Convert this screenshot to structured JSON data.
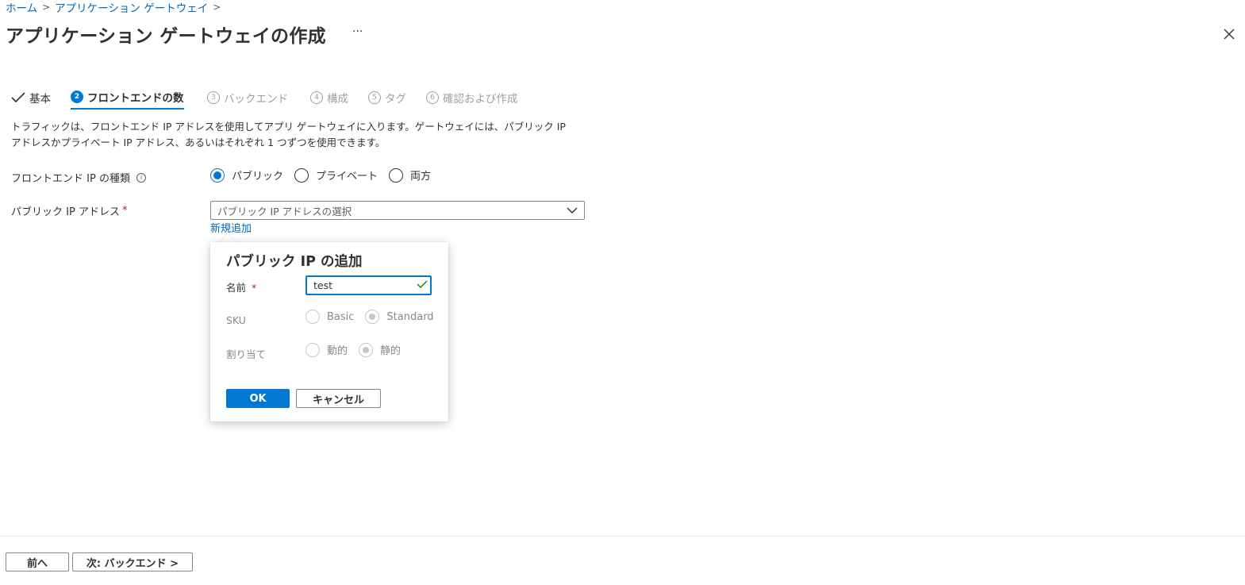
{
  "breadcrumb": {
    "home": "ホーム",
    "separator": ">",
    "app_gateway": "アプリケーション ゲートウェイ"
  },
  "header": {
    "title": "アプリケーション ゲートウェイの作成",
    "more": "···",
    "close_icon": "close-icon"
  },
  "tabs": [
    {
      "num": "",
      "label": "基本",
      "state": "done"
    },
    {
      "num": "2",
      "label": "フロントエンドの数",
      "state": "active"
    },
    {
      "num": "3",
      "label": "バックエンド",
      "state": "todo"
    },
    {
      "num": "4",
      "label": "構成",
      "state": "todo"
    },
    {
      "num": "5",
      "label": "タグ",
      "state": "todo"
    },
    {
      "num": "6",
      "label": "確認および作成",
      "state": "todo"
    }
  ],
  "description": {
    "line1": "トラフィックは、フロントエンド IP アドレスを使用してアプリ ゲートウェイに入ります。ゲートウェイには、パブリック IP",
    "line2": "アドレスかプライベート IP アドレス、あるいはそれぞれ 1 つずつを使用できます。"
  },
  "frontend_ip_type": {
    "label": "フロントエンド IP の種類",
    "info_icon": "i",
    "options": [
      "パブリック",
      "プライベート",
      "両方"
    ],
    "selected": "パブリック"
  },
  "public_ip": {
    "label": "パブリック IP アドレス",
    "required_mark": "*",
    "placeholder": "パブリック IP アドレスの選択",
    "add_new_link": "新規追加"
  },
  "callout": {
    "title": "パブリック IP の追加",
    "name_label": "名前",
    "required_mark": "*",
    "name_value": "test",
    "sku_label": "SKU",
    "sku_options": [
      "Basic",
      "Standard"
    ],
    "sku_selected": "Standard",
    "assignment_label": "割り当て",
    "assignment_options": [
      "動的",
      "静的"
    ],
    "assignment_selected": "静的",
    "ok": "OK",
    "cancel": "キャンセル"
  },
  "footer": {
    "prev": "前へ",
    "next": "次: バックエンド >"
  },
  "colors": {
    "accent": "#0078d4",
    "link": "#0067b8",
    "required": "#a4262c",
    "valid_check": "#107c10"
  }
}
